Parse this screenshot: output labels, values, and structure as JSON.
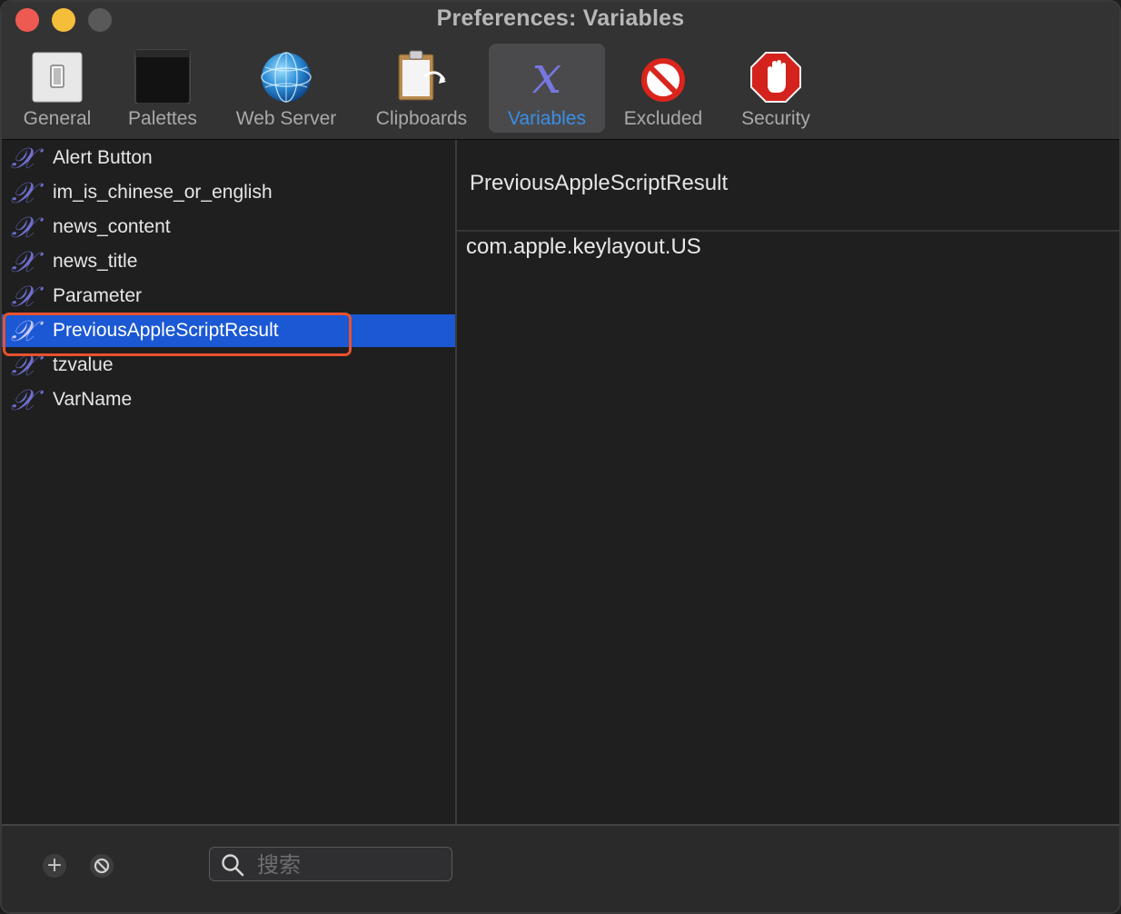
{
  "window": {
    "title": "Preferences: Variables"
  },
  "toolbar": {
    "items": [
      {
        "label": "General",
        "icon": "general-switch-icon"
      },
      {
        "label": "Palettes",
        "icon": "palettes-icon"
      },
      {
        "label": "Web Server",
        "icon": "globe-icon"
      },
      {
        "label": "Clipboards",
        "icon": "clipboard-icon"
      },
      {
        "label": "Variables",
        "icon": "variable-x-icon",
        "selected": true
      },
      {
        "label": "Excluded",
        "icon": "prohibited-icon"
      },
      {
        "label": "Security",
        "icon": "stop-hand-icon"
      }
    ]
  },
  "variables": {
    "icon_glyph": "𝒳",
    "items": [
      {
        "name": "Alert Button"
      },
      {
        "name": "im_is_chinese_or_english"
      },
      {
        "name": "news_content"
      },
      {
        "name": "news_title"
      },
      {
        "name": "Parameter"
      },
      {
        "name": "PreviousAppleScriptResult",
        "selected": true
      },
      {
        "name": "tzvalue"
      },
      {
        "name": "VarName"
      }
    ]
  },
  "detail": {
    "name": "PreviousAppleScriptResult",
    "value": "com.apple.keylayout.US"
  },
  "bottom": {
    "add_label": "+",
    "search_placeholder": "搜索"
  },
  "colors": {
    "accent": "#1b58d4",
    "selected_tab_text": "#3a8ee6",
    "highlight_border": "#e8512e",
    "variable_icon": "#6f6fd0"
  }
}
